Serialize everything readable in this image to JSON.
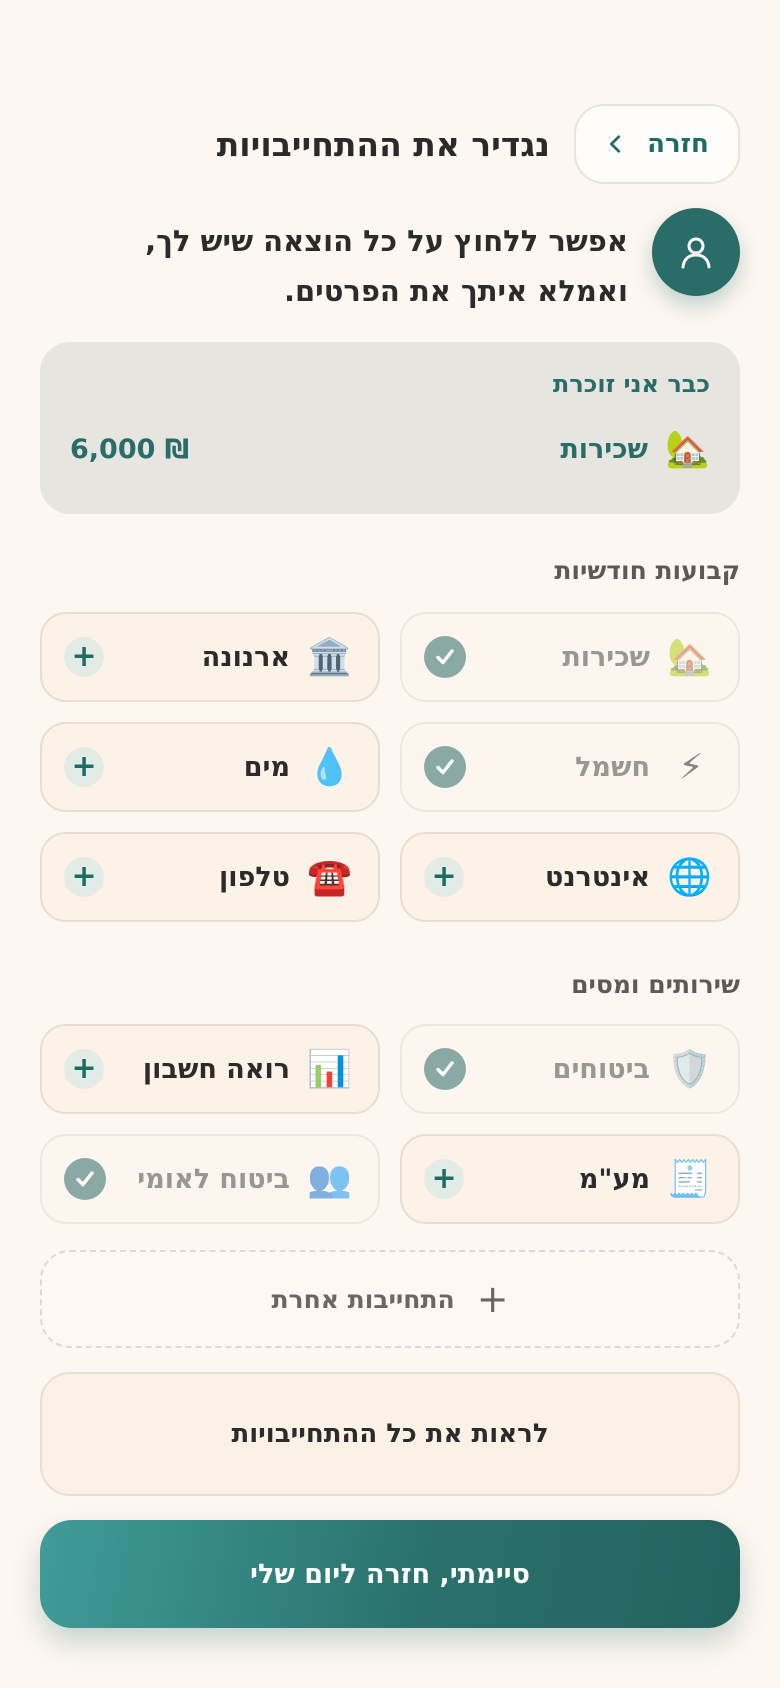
{
  "header": {
    "title": "נגדיר את ההתחייבויות",
    "back_label": "חזרה"
  },
  "intro": {
    "text": "אפשר ללחוץ על כל הוצאה שיש לך, ואמלא איתך את הפרטים."
  },
  "memory": {
    "title": "כבר אני זוכרת",
    "item_label": "שכירות",
    "item_icon": "house-emoji",
    "item_emoji": "🏡",
    "amount": "6,000 ₪"
  },
  "monthly": {
    "title": "קבועות חודשיות",
    "tiles": [
      {
        "label": "שכירות",
        "emoji": "🏡",
        "icon": "house-icon",
        "status": "done"
      },
      {
        "label": "ארנונה",
        "emoji": "🏛️",
        "icon": "government-building-icon",
        "status": "add"
      },
      {
        "label": "חשמל",
        "emoji": "⚡",
        "icon": "lightning-icon",
        "status": "done"
      },
      {
        "label": "מים",
        "emoji": "💧",
        "icon": "water-drop-icon",
        "status": "add"
      },
      {
        "label": "אינטרנט",
        "emoji": "🌐",
        "icon": "globe-icon",
        "status": "add"
      },
      {
        "label": "טלפון",
        "emoji": "☎️",
        "icon": "telephone-icon",
        "status": "add"
      }
    ]
  },
  "services": {
    "title": "שירותים ומסים",
    "tiles": [
      {
        "label": "ביטוחים",
        "emoji": "🛡️",
        "icon": "shield-icon",
        "status": "done"
      },
      {
        "label": "רואה חשבון",
        "emoji": "📊",
        "icon": "bar-chart-icon",
        "status": "add"
      },
      {
        "label": "מע\"מ",
        "emoji": "🧾",
        "icon": "receipt-icon",
        "status": "add"
      },
      {
        "label": "ביטוח לאומי",
        "emoji": "👥",
        "icon": "people-icon",
        "status": "done"
      }
    ]
  },
  "actions": {
    "other_label": "התחייבות אחרת",
    "view_all_label": "לראות את כל ההתחייבויות",
    "done_label": "סיימתי, חזרה ליום שלי"
  },
  "colors": {
    "accent": "#2a6c68",
    "background": "#fdf7f1",
    "tile_bg": "#fcf2e8",
    "done_check": "#8aa9a5"
  }
}
